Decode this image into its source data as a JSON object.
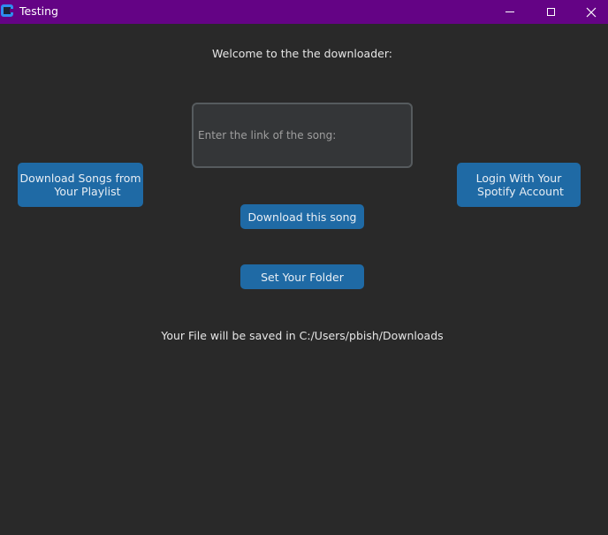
{
  "window": {
    "title": "Testing",
    "titlebar_color": "#640385",
    "background_color": "#292929",
    "controls": {
      "minimize_icon": "minimize-icon",
      "maximize_icon": "maximize-icon",
      "close_icon": "close-icon"
    }
  },
  "main": {
    "welcome_text": "Welcome to the the downloader:",
    "link_input": {
      "value": "",
      "placeholder": "Enter the link of the song:"
    },
    "playlist_button_label": "Download Songs from\n    Your Playlist",
    "login_button_label": "Login With Your\n Spotify Account",
    "download_button_label": "Download this song",
    "folder_button_label": "Set Your Folder",
    "save_path_text": "Your File will be saved in C:/Users/pbish/Downloads",
    "button_color": "#1f6aa5"
  }
}
